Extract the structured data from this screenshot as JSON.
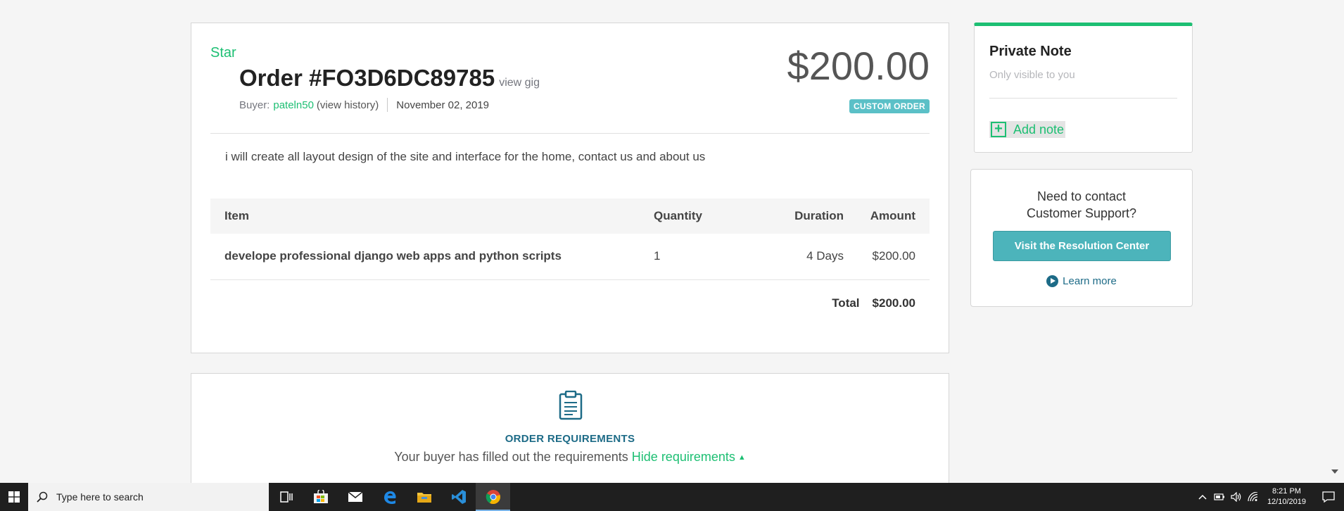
{
  "order": {
    "star_label": "Star",
    "title": "Order #FO3D6DC89785",
    "view_gig": "view gig",
    "buyer_prefix": "Buyer:",
    "buyer_name": "pateln50",
    "view_history": "(view history)",
    "date": "November 02, 2019",
    "price": "$200.00",
    "badge": "CUSTOM ORDER",
    "description": "i will create all layout design of the site and interface for the home, contact us and about us",
    "table": {
      "headers": [
        "Item",
        "Quantity",
        "Duration",
        "Amount"
      ],
      "rows": [
        [
          "develope professional django web apps and python scripts",
          "1",
          "4 Days",
          "$200.00"
        ]
      ],
      "total_label": "Total",
      "total_value": "$200.00"
    }
  },
  "requirements": {
    "title": "ORDER REQUIREMENTS",
    "subtitle": "Your buyer has filled out the requirements",
    "hide_link": "Hide requirements",
    "arrow": "▲"
  },
  "private_note": {
    "title": "Private Note",
    "subtitle": "Only visible to you",
    "add_label": "Add note"
  },
  "support": {
    "line1": "Need to contact",
    "line2": "Customer Support?",
    "button": "Visit the Resolution Center",
    "learn_more": "Learn more"
  },
  "taskbar": {
    "search_placeholder": "Type here to search",
    "time": "8:21 PM",
    "date": "12/10/2019",
    "apps": [
      "task-view-icon",
      "store-icon",
      "mail-icon",
      "edge-icon",
      "file-explorer-icon",
      "vscode-icon",
      "chrome-icon"
    ]
  },
  "colors": {
    "accent_green": "#1dbf73",
    "teal": "#4cb4bb",
    "dark_teal": "#1d6b87"
  }
}
